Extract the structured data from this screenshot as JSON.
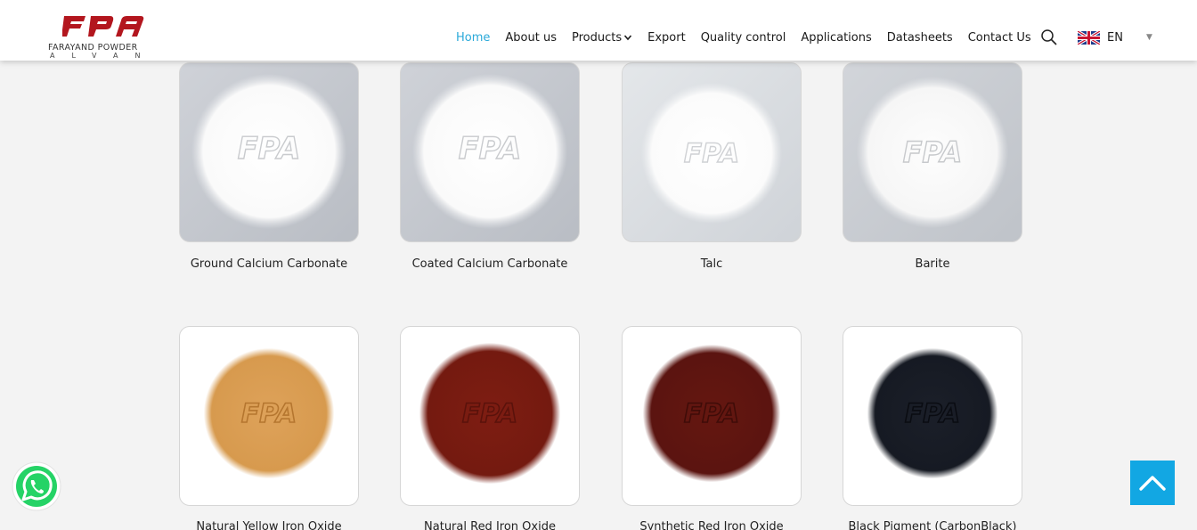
{
  "header": {
    "logo_mark": "FPA",
    "company_name": "FARAYAND POWDER",
    "company_sub": "ALVAN",
    "brand_color": "#b3161e"
  },
  "nav": {
    "items": [
      {
        "label": "Home",
        "active": true
      },
      {
        "label": "About us"
      },
      {
        "label": "Products",
        "has_dropdown": true
      },
      {
        "label": "Export"
      },
      {
        "label": "Quality control"
      },
      {
        "label": "Applications"
      },
      {
        "label": "Datasheets"
      },
      {
        "label": "Contact Us"
      }
    ],
    "active_color": "#2aa9d9",
    "search_icon": "search-icon",
    "language": {
      "code": "EN",
      "flag_icon": "uk-flag-icon",
      "caret_icon": "caret-down-icon"
    }
  },
  "products": [
    {
      "name": "Ground Calcium Carbonate",
      "powder_color": "#ffffff"
    },
    {
      "name": "Coated Calcium Carbonate",
      "powder_color": "#ffffff"
    },
    {
      "name": "Talc",
      "powder_color": "#ffffff"
    },
    {
      "name": "Barite",
      "powder_color": "#fbfbfb"
    },
    {
      "name": "Natural Yellow Iron Oxide",
      "powder_color": "#d99a4f"
    },
    {
      "name": "Natural Red Iron Oxide",
      "powder_color": "#7a1a10"
    },
    {
      "name": "Synthetic Red Iron Oxide",
      "powder_color": "#5e1510"
    },
    {
      "name": "Black Pigment (CarbonBlack)",
      "powder_color": "#181c26"
    }
  ],
  "floating": {
    "whatsapp_icon": "whatsapp-icon",
    "whatsapp_color": "#25d366",
    "back_to_top_icon": "chevron-up-icon",
    "back_to_top_color": "#12a7e3"
  }
}
